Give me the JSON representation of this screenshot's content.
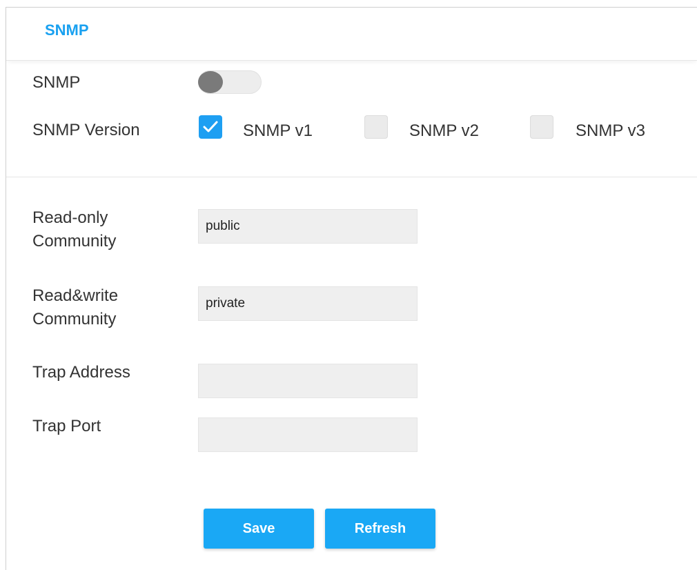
{
  "header": {
    "title": "SNMP"
  },
  "snmp": {
    "label": "SNMP",
    "enabled": false
  },
  "version": {
    "label": "SNMP Version",
    "options": [
      {
        "label": "SNMP v1",
        "checked": true
      },
      {
        "label": "SNMP v2",
        "checked": false
      },
      {
        "label": "SNMP v3",
        "checked": false
      }
    ]
  },
  "fields": {
    "read_only": {
      "label_line1": "Read-only",
      "label_line2": "Community",
      "value": "public"
    },
    "read_write": {
      "label_line1": "Read&write",
      "label_line2": "Community",
      "value": "private"
    },
    "trap_address": {
      "label": "Trap Address",
      "value": ""
    },
    "trap_port": {
      "label": "Trap Port",
      "value": ""
    }
  },
  "buttons": {
    "save": "Save",
    "refresh": "Refresh"
  },
  "colors": {
    "accent": "#1aa1f0",
    "button": "#1aa8f5",
    "checkbox_checked": "#1e9ff2"
  }
}
